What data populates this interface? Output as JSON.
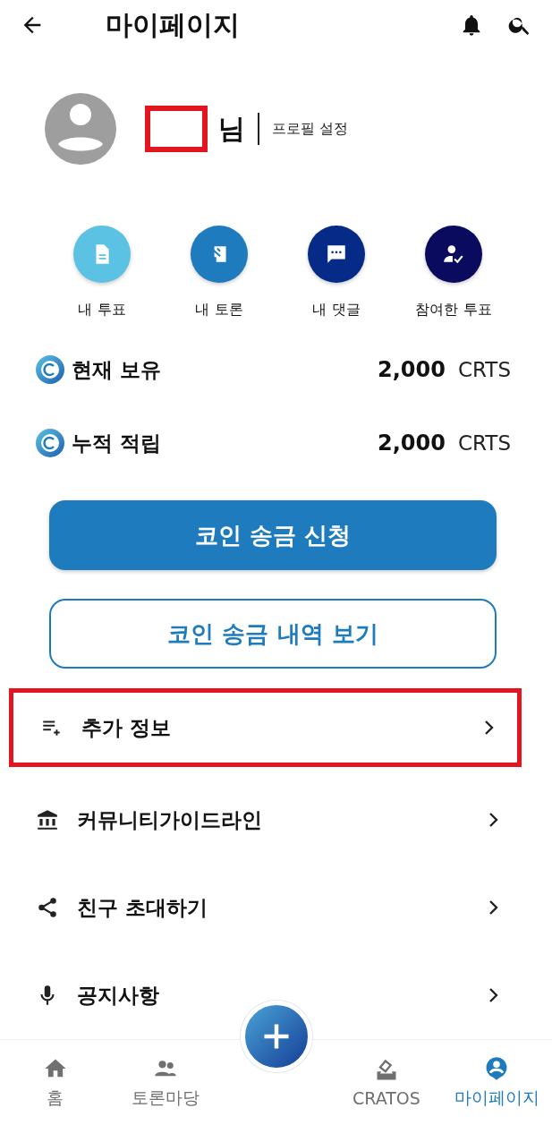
{
  "header": {
    "title": "마이페이지"
  },
  "profile": {
    "name_redacted": true,
    "name_suffix": "님",
    "settings_link": "프로필 설정"
  },
  "shortcuts": [
    {
      "kind": "vote",
      "label": "내 투표",
      "color": "#5bc2e3"
    },
    {
      "kind": "debate",
      "label": "내 토론",
      "color": "#1e7bbd"
    },
    {
      "kind": "comment",
      "label": "내 댓글",
      "color": "#062a88"
    },
    {
      "kind": "participated",
      "label": "참여한 투표",
      "color": "#0a0a5e"
    }
  ],
  "balances": [
    {
      "label": "현재 보유",
      "amount": "2,000",
      "unit": "CRTS"
    },
    {
      "label": "누적 적립",
      "amount": "2,000",
      "unit": "CRTS"
    }
  ],
  "buttons": [
    {
      "kind": "primary",
      "label": "코인 송금 신청"
    },
    {
      "kind": "outline",
      "label": "코인 송금 내역 보기"
    }
  ],
  "menu": [
    {
      "kind": "add-list",
      "label": "추가 정보",
      "highlighted": true
    },
    {
      "kind": "bank",
      "label": "커뮤니티가이드라인",
      "highlighted": false
    },
    {
      "kind": "share",
      "label": "친구 초대하기",
      "highlighted": false
    },
    {
      "kind": "mic",
      "label": "공지사항",
      "highlighted": false
    }
  ],
  "bottom_nav": [
    {
      "kind": "home",
      "label": "홈",
      "selected": false
    },
    {
      "kind": "people",
      "label": "토론마당",
      "selected": false
    },
    {
      "kind": "fab"
    },
    {
      "kind": "ballot",
      "label": "CRATOS",
      "selected": false
    },
    {
      "kind": "user",
      "label": "마이페이지",
      "selected": true
    }
  ]
}
